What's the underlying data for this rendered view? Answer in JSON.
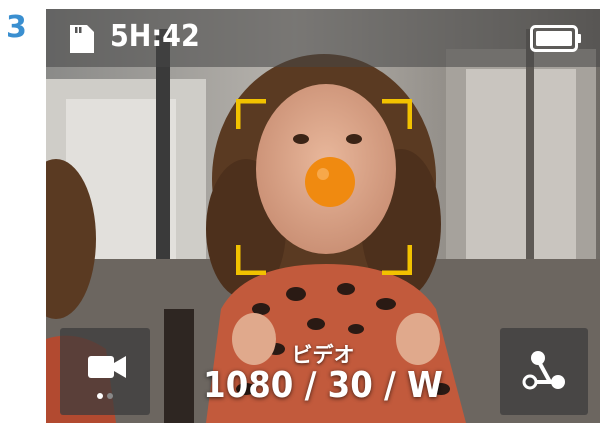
{
  "step_number": "3",
  "status_bar": {
    "storage_icon": "sd-card-icon",
    "remaining_time": "5H:42",
    "battery_icon": "battery-full-icon"
  },
  "focus_frame_icon": "focus-brackets-icon",
  "mode": {
    "name": "ビデオ",
    "settings": "1080 / 30 / W",
    "page_indicator": {
      "pages": 2,
      "active": 1
    }
  },
  "buttons": {
    "mode_icon": "video-camera-icon",
    "share_icon": "connect-share-icon"
  },
  "colors": {
    "step_number": "#3a8fd0",
    "focus_frame": "#f2c200"
  }
}
